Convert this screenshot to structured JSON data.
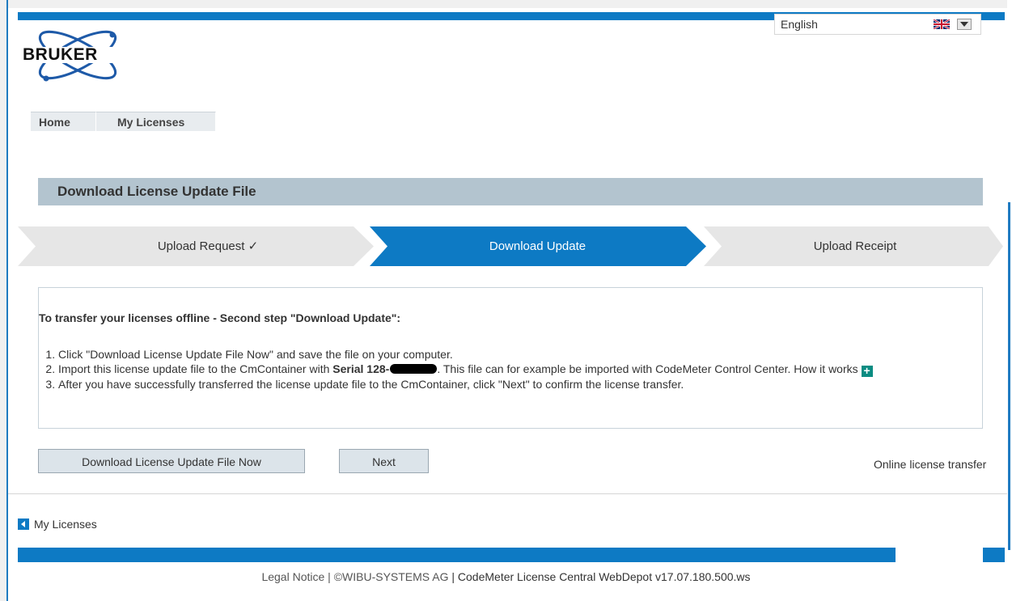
{
  "language_selector": {
    "value": "English",
    "flag": "uk-flag-icon",
    "dropdown": "chevron-down-icon"
  },
  "logo": {
    "text": "BRUKER"
  },
  "nav": {
    "items": [
      {
        "label": "Home"
      },
      {
        "label": "My Licenses"
      }
    ]
  },
  "page": {
    "title": "Download License Update File"
  },
  "steps": [
    {
      "label": "Upload Request ✓",
      "state": "done"
    },
    {
      "label": "Download Update",
      "state": "active"
    },
    {
      "label": "Upload Receipt",
      "state": "pending"
    }
  ],
  "instructions": {
    "heading": "To transfer your licenses offline - Second step \"Download Update\":",
    "item1": "Click \"Download License Update File Now\" and save the file on your computer.",
    "item2_prefix": "Import this license update file to the CmContainer with ",
    "item2_serial": "Serial 128-",
    "item2_suffix": ". This file can for example be imported with CodeMeter Control Center. How it works",
    "item3": "After you have successfully transferred the license update file to the CmContainer, click \"Next\" to confirm the license transfer."
  },
  "buttons": {
    "download": "Download License Update File Now",
    "next": "Next"
  },
  "online_link": "Online license transfer",
  "back_link": "My Licenses",
  "footer": {
    "legal": "Legal Notice | ©WIBU-SYSTEMS AG",
    "separator": " | ",
    "product": "CodeMeter License Central WebDepot v17.07.180.500.ws"
  },
  "colors": {
    "accent": "#0d7ac4",
    "step_inactive": "#e6e6e6",
    "title_bar": "#b3c4cf",
    "plus": "#0b8c82"
  }
}
